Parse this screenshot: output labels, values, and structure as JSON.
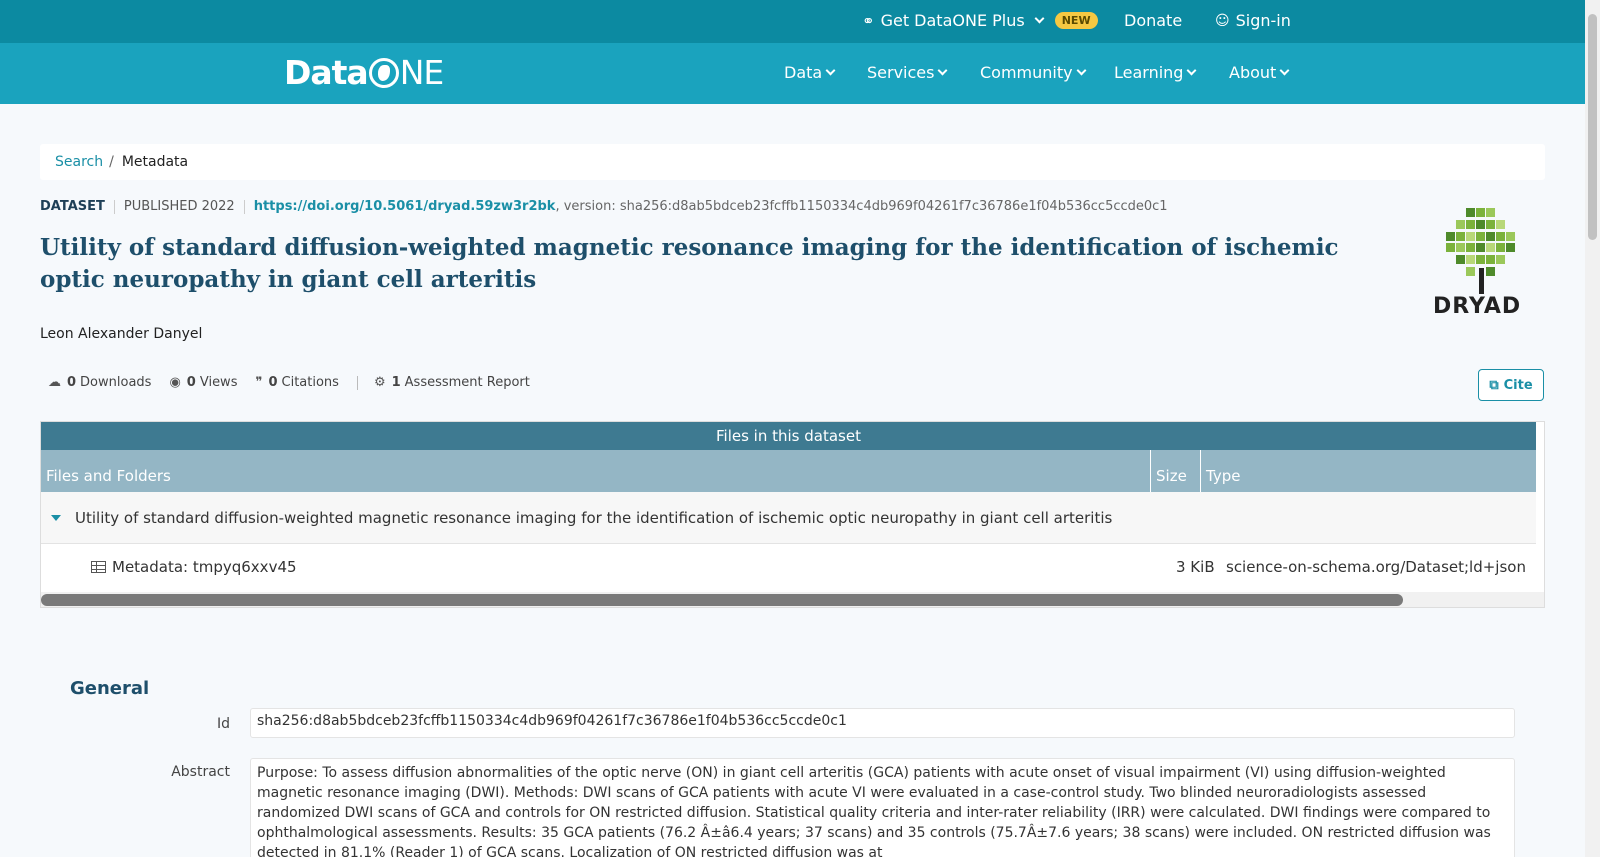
{
  "topbar": {
    "plus_label": "Get DataONE Plus",
    "new_badge": "NEW",
    "donate": "Donate",
    "signin": "Sign-in"
  },
  "logo": {
    "part1": "Data",
    "part2": "NE"
  },
  "nav": [
    "Data",
    "Services",
    "Community",
    "Learning",
    "About"
  ],
  "breadcrumb": {
    "search": "Search",
    "separator": "/",
    "current": "Metadata"
  },
  "meta": {
    "type": "DATASET",
    "published": "PUBLISHED 2022",
    "doi": "https://doi.org/10.5061/dryad.59zw3r2bk",
    "version": ", version: sha256:d8ab5bdceb23fcffb1150334c4db969f04261f7c36786e1f04b536cc5ccde0c1"
  },
  "title": "Utility of standard diffusion-weighted magnetic resonance imaging for the identification of ischemic optic neuropathy in giant cell arteritis",
  "author": "Leon Alexander Danyel",
  "repository_logo": "DRYAD",
  "stats": {
    "downloads_count": "0",
    "downloads_label": "Downloads",
    "views_count": "0",
    "views_label": "Views",
    "citations_count": "0",
    "citations_label": "Citations",
    "assessment_count": "1",
    "assessment_label": "Assessment Report"
  },
  "cite_label": "Cite",
  "files": {
    "header": "Files in this dataset",
    "columns": [
      "Files and Folders",
      "Size",
      "Type"
    ],
    "folder": "Utility of standard diffusion-weighted magnetic resonance imaging for the identification of ischemic optic neuropathy in giant cell arteritis",
    "rows": [
      {
        "name": "Metadata: tmpyq6xxv45",
        "size": "3 KiB",
        "type": "science-on-schema.org/Dataset;ld+json"
      }
    ]
  },
  "general": {
    "heading": "General",
    "id_label": "Id",
    "id_value": "sha256:d8ab5bdceb23fcffb1150334c4db969f04261f7c36786e1f04b536cc5ccde0c1",
    "abstract_label": "Abstract",
    "abstract_value": "Purpose: To assess diffusion abnormalities of the optic nerve (ON) in giant cell arteritis (GCA) patients with acute onset of visual impairment (VI) using diffusion-weighted magnetic resonance imaging (DWI). Methods: DWI scans of GCA patients with acute VI were evaluated in a case-control study. Two blinded neuroradiologists assessed randomized DWI scans of GCA and controls for ON restricted diffusion. Statistical quality criteria and inter-rater reliability (IRR) were calculated. DWI findings were compared to ophthalmological assessments. Results: 35 GCA patients (76.2 Â±â6.4 years; 37 scans) and 35 controls (75.7Â±7.6 years; 38 scans) were included. ON restricted diffusion was detected in 81.1% (Reader 1) of GCA scans. Localization of ON restricted diffusion was at"
  },
  "colors": {
    "topbar": "#0c8aa1",
    "nav": "#1aa3be",
    "accent": "#1a8fa6",
    "title": "#1e4f6b"
  }
}
